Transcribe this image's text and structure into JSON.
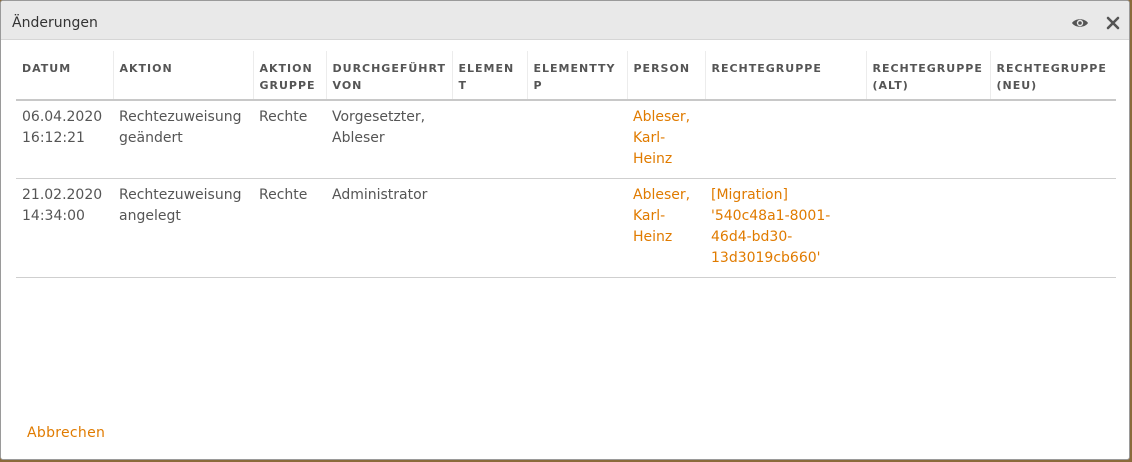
{
  "dialog": {
    "title": "Änderungen",
    "icons": [
      "eye-icon",
      "close-icon"
    ]
  },
  "table": {
    "headers": [
      "DATUM",
      "AKTION",
      "AKTION GRUPPE",
      "DURCHGEFÜHRT VON",
      "ELEMENT",
      "ELEMENTTYP",
      "PERSON",
      "RECHTEGRUPPE",
      "RECHTEGRUPPE (ALT)",
      "RECHTEGRUPPE (NEU)"
    ],
    "rows": [
      {
        "datum": "06.04.2020 16:12:21",
        "aktion": "Rechtezuweisung geändert",
        "aktion_gruppe": "Rechte",
        "durchgefuehrt_von": "Vorgesetzter, Ableser",
        "element": "",
        "elementtyp": "",
        "person": "Ableser, Karl-Heinz",
        "rechtegruppe": "",
        "rechtegruppe_alt": "",
        "rechtegruppe_neu": ""
      },
      {
        "datum": "21.02.2020 14:34:00",
        "aktion": "Rechtezuweisung angelegt",
        "aktion_gruppe": "Rechte",
        "durchgefuehrt_von": "Administrator",
        "element": "",
        "elementtyp": "",
        "person": "Ableser, Karl-Heinz",
        "rechtegruppe": "[Migration] '540c48a1-8001-46d4-bd30-13d3019cb660'",
        "rechtegruppe_alt": "",
        "rechtegruppe_neu": ""
      }
    ]
  },
  "footer": {
    "cancel_label": "Abbrechen"
  },
  "colors": {
    "accent": "#e07b00",
    "text": "#555555",
    "titlebar": "#e9e9e9"
  }
}
